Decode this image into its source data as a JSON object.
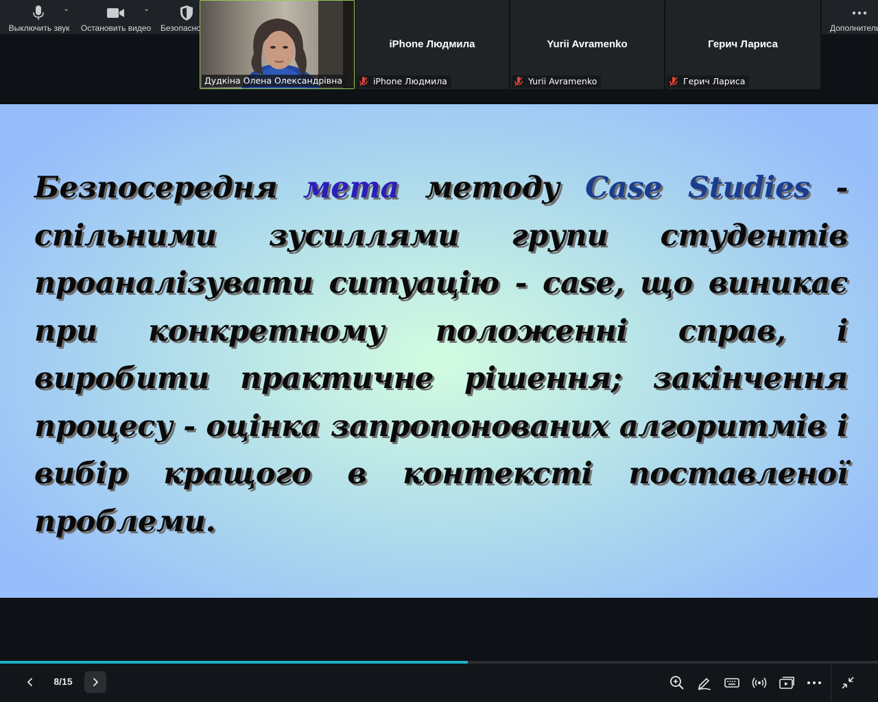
{
  "toolbar": {
    "mute_label": "Выключить звук",
    "video_label": "Остановить видео",
    "security_label": "Безопасность",
    "more_label": "Дополнительно"
  },
  "participants": [
    {
      "name": "Дудкіна Олена Олександрівна",
      "has_video": true
    },
    {
      "name": "iPhone Людмила",
      "muted": true
    },
    {
      "name": "Yurii Avramenko",
      "muted": true
    },
    {
      "name": "Герич Лариса",
      "muted": true
    }
  ],
  "slide": {
    "seg1": "Безпосередня ",
    "seg2": "мета",
    "seg3": " методу ",
    "seg4": "Case Studies",
    "seg5": " - спільними зусиллями групи студентів проаналізувати ситуацію - case, що виникає при конкретному положенні справ, і виробити практичне рішення; закінчення процесу - оцінка запропонованих алгоритмів і вибір кращого в контексті поставленої проблеми."
  },
  "presentation": {
    "page_indicator": "8/15",
    "progress_fraction": 0.533
  },
  "colors": {
    "accent_progress": "#1ab3c8",
    "highlight_purple": "#2c1fb8",
    "highlight_blue": "#1b3d8f",
    "active_speaker_border": "#96c856",
    "muted_red": "#e0443a"
  },
  "icons": [
    "microphone-icon",
    "video-camera-icon",
    "shield-icon",
    "more-icon",
    "muted-mic-icon",
    "chevron-left-icon",
    "chevron-right-icon",
    "zoom-in-icon",
    "pen-icon",
    "keyboard-icon",
    "broadcast-icon",
    "screen-share-icon",
    "more-options-icon",
    "collapse-icon"
  ]
}
